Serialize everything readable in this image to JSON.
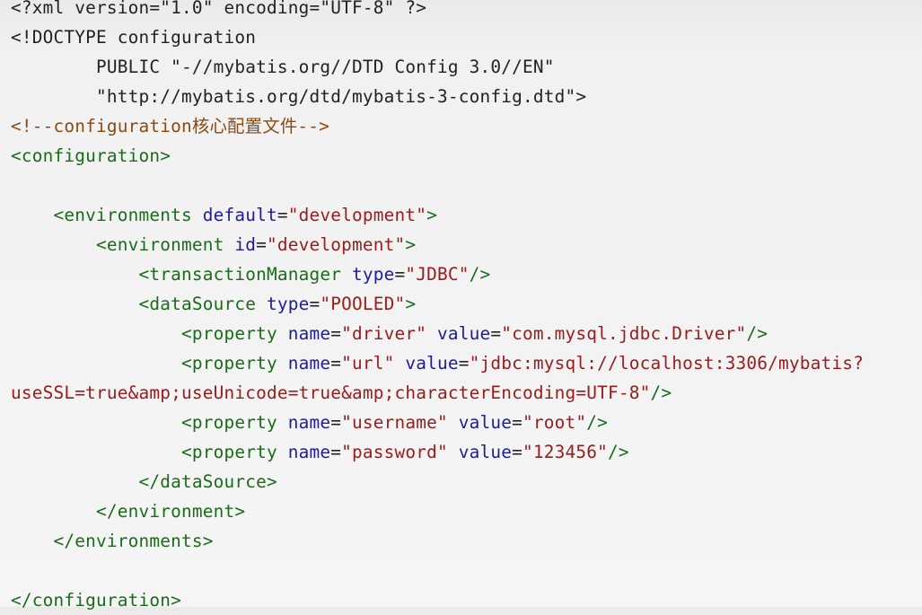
{
  "code": {
    "language": "xml",
    "colors": {
      "background": "#f3f3f3",
      "plain": "#222222",
      "tag": "#1a6b1a",
      "attribute": "#1c1c9c",
      "value": "#9b1b1b",
      "comment": "#8b4a13"
    },
    "lines": [
      [
        {
          "t": "plain",
          "s": "<?xml version=\"1.0\" encoding=\"UTF-8\" ?>"
        }
      ],
      [
        {
          "t": "plain",
          "s": "<!DOCTYPE configuration"
        }
      ],
      [
        {
          "t": "plain",
          "s": "        PUBLIC \"-//mybatis.org//DTD Config 3.0//EN\""
        }
      ],
      [
        {
          "t": "plain",
          "s": "        \"http://mybatis.org/dtd/mybatis-3-config.dtd\">"
        }
      ],
      [
        {
          "t": "comment",
          "s": "<!--configuration核心配置文件-->"
        }
      ],
      [
        {
          "t": "tag",
          "s": "<configuration>"
        }
      ],
      [],
      [
        {
          "t": "tag",
          "s": "    <environments "
        },
        {
          "t": "attr",
          "s": "default"
        },
        {
          "t": "plain",
          "s": "="
        },
        {
          "t": "val",
          "s": "\"development\""
        },
        {
          "t": "tag",
          "s": ">"
        }
      ],
      [
        {
          "t": "tag",
          "s": "        <environment "
        },
        {
          "t": "attr",
          "s": "id"
        },
        {
          "t": "plain",
          "s": "="
        },
        {
          "t": "val",
          "s": "\"development\""
        },
        {
          "t": "tag",
          "s": ">"
        }
      ],
      [
        {
          "t": "tag",
          "s": "            <transactionManager "
        },
        {
          "t": "attr",
          "s": "type"
        },
        {
          "t": "plain",
          "s": "="
        },
        {
          "t": "val",
          "s": "\"JDBC\""
        },
        {
          "t": "tag",
          "s": "/>"
        }
      ],
      [
        {
          "t": "tag",
          "s": "            <dataSource "
        },
        {
          "t": "attr",
          "s": "type"
        },
        {
          "t": "plain",
          "s": "="
        },
        {
          "t": "val",
          "s": "\"POOLED\""
        },
        {
          "t": "tag",
          "s": ">"
        }
      ],
      [
        {
          "t": "tag",
          "s": "                <property "
        },
        {
          "t": "attr",
          "s": "name"
        },
        {
          "t": "plain",
          "s": "="
        },
        {
          "t": "val",
          "s": "\"driver\""
        },
        {
          "t": "plain",
          "s": " "
        },
        {
          "t": "attr",
          "s": "value"
        },
        {
          "t": "plain",
          "s": "="
        },
        {
          "t": "val",
          "s": "\"com.mysql.jdbc.Driver\""
        },
        {
          "t": "tag",
          "s": "/>"
        }
      ],
      [
        {
          "t": "tag",
          "s": "                <property "
        },
        {
          "t": "attr",
          "s": "name"
        },
        {
          "t": "plain",
          "s": "="
        },
        {
          "t": "val",
          "s": "\"url\""
        },
        {
          "t": "plain",
          "s": " "
        },
        {
          "t": "attr",
          "s": "value"
        },
        {
          "t": "plain",
          "s": "="
        },
        {
          "t": "val",
          "s": "\"jdbc:mysql://localhost:3306/mybatis?"
        }
      ],
      [
        {
          "t": "val",
          "s": "useSSL=true&amp;useUnicode=true&amp;characterEncoding=UTF-8\""
        },
        {
          "t": "tag",
          "s": "/>"
        }
      ],
      [
        {
          "t": "tag",
          "s": "                <property "
        },
        {
          "t": "attr",
          "s": "name"
        },
        {
          "t": "plain",
          "s": "="
        },
        {
          "t": "val",
          "s": "\"username\""
        },
        {
          "t": "plain",
          "s": " "
        },
        {
          "t": "attr",
          "s": "value"
        },
        {
          "t": "plain",
          "s": "="
        },
        {
          "t": "val",
          "s": "\"root\""
        },
        {
          "t": "tag",
          "s": "/>"
        }
      ],
      [
        {
          "t": "tag",
          "s": "                <property "
        },
        {
          "t": "attr",
          "s": "name"
        },
        {
          "t": "plain",
          "s": "="
        },
        {
          "t": "val",
          "s": "\"password\""
        },
        {
          "t": "plain",
          "s": " "
        },
        {
          "t": "attr",
          "s": "value"
        },
        {
          "t": "plain",
          "s": "="
        },
        {
          "t": "val",
          "s": "\"123456\""
        },
        {
          "t": "tag",
          "s": "/>"
        }
      ],
      [
        {
          "t": "tag",
          "s": "            </dataSource>"
        }
      ],
      [
        {
          "t": "tag",
          "s": "        </environment>"
        }
      ],
      [
        {
          "t": "tag",
          "s": "    </environments>"
        }
      ],
      [],
      [
        {
          "t": "tag",
          "s": "</configuration>"
        }
      ]
    ]
  }
}
